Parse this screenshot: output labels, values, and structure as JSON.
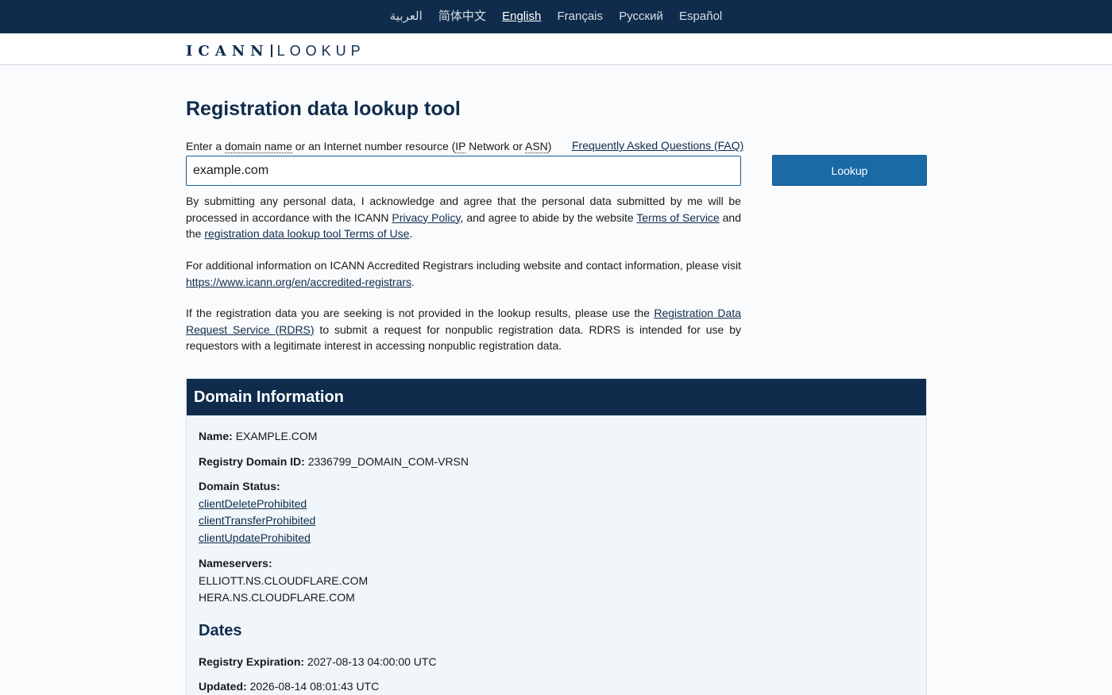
{
  "languages": [
    {
      "label": "العربية",
      "active": false
    },
    {
      "label": "简体中文",
      "active": false
    },
    {
      "label": "English",
      "active": true
    },
    {
      "label": "Français",
      "active": false
    },
    {
      "label": "Русский",
      "active": false
    },
    {
      "label": "Español",
      "active": false
    }
  ],
  "brand": {
    "part1": "ICANN",
    "part2": "LOOKUP"
  },
  "page_title": "Registration data lookup tool",
  "prompt": {
    "pre": "Enter a ",
    "domain_name": "domain name",
    "mid": " or an Internet number resource (",
    "ip": "IP",
    "network_or": " Network or ",
    "asn": "ASN",
    "post": ")"
  },
  "faq_link": "Frequently Asked Questions (FAQ)",
  "search": {
    "value": "example.com",
    "placeholder": ""
  },
  "lookup_button": "Lookup",
  "consent": {
    "t1": "By submitting any personal data, I acknowledge and agree that the personal data submitted by me will be processed in accordance with the ICANN ",
    "privacy_link": "Privacy Policy",
    "t2": ", and agree to abide by the website ",
    "tos_link": "Terms of Service",
    "t3": " and the ",
    "tou_link": "registration data lookup tool Terms of Use",
    "t4": "."
  },
  "registrars_info": {
    "t1": "For additional information on ICANN Accredited Registrars including website and contact information, please visit ",
    "link": "https://www.icann.org/en/accredited-registrars",
    "t2": "."
  },
  "rdrs_info": {
    "t1": "If the registration data you are seeking is not provided in the lookup results, please use the ",
    "link": "Registration Data Request Service (RDRS)",
    "t2": " to submit a request for nonpublic registration data. RDRS is intended for use by requestors with a legitimate interest in accessing nonpublic registration data."
  },
  "domain_info": {
    "heading": "Domain Information",
    "name_label": "Name:",
    "name_value": "EXAMPLE.COM",
    "registry_id_label": "Registry Domain ID:",
    "registry_id_value": "2336799_DOMAIN_COM-VRSN",
    "status_label": "Domain Status:",
    "statuses": [
      "clientDeleteProhibited",
      "clientTransferProhibited",
      "clientUpdateProhibited"
    ],
    "nameservers_label": "Nameservers:",
    "nameservers": [
      "ELLIOTT.NS.CLOUDFLARE.COM",
      "HERA.NS.CLOUDFLARE.COM"
    ]
  },
  "dates": {
    "heading": "Dates",
    "expiration_label": "Registry Expiration:",
    "expiration_value": "2027-08-13 04:00:00 UTC",
    "updated_label": "Updated:",
    "updated_value": "2026-08-14 08:01:43 UTC"
  },
  "colors": {
    "navy": "#0f2c4c",
    "button_blue": "#1a6aa5",
    "panel_bg": "#f0f6fa"
  }
}
